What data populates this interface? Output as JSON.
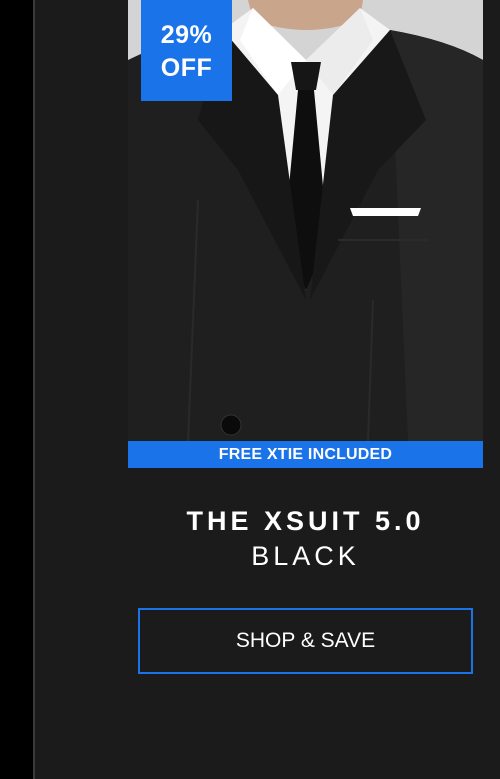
{
  "badge": {
    "line1": "29%",
    "line2": "OFF"
  },
  "promo": {
    "text": "FREE XTIE INCLUDED"
  },
  "product": {
    "name": "THE XSUIT 5.0",
    "color": "BLACK"
  },
  "cta": {
    "label": "SHOP & SAVE"
  },
  "colors": {
    "accent": "#1a73e8",
    "background": "#1b1b1b",
    "rail": "#000000"
  }
}
